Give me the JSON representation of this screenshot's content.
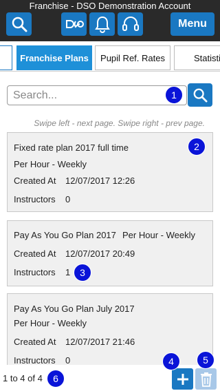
{
  "header": {
    "title": "Franchise - DSO Demonstration Account",
    "menu_label": "Menu"
  },
  "tabs": [
    {
      "label": "Franchise Plans",
      "active": true
    },
    {
      "label": "Pupil Ref. Rates",
      "active": false
    },
    {
      "label": "Statisti",
      "active": false
    }
  ],
  "search": {
    "placeholder": "Search...",
    "value": ""
  },
  "hint": "Swipe left - next page. Swipe right - prev page.",
  "plans": [
    {
      "name": "Fixed rate plan 2017 full time",
      "rate_type": "Per Hour - Weekly",
      "created_label": "Created At",
      "created_at": "12/07/2017 12:26",
      "instructors_label": "Instructors",
      "instructors": "0"
    },
    {
      "name": "Pay As You Go Plan 2017",
      "rate_type": "Per Hour - Weekly",
      "created_label": "Created At",
      "created_at": "12/07/2017 20:49",
      "instructors_label": "Instructors",
      "instructors": "1"
    },
    {
      "name": "Pay As You Go Plan July 2017",
      "rate_type": "Per Hour - Weekly",
      "created_label": "Created At",
      "created_at": "12/07/2017 21:46",
      "instructors_label": "Instructors",
      "instructors": "0"
    }
  ],
  "paging": "1 to 4 of 4",
  "markers": [
    "1",
    "2",
    "3",
    "4",
    "5",
    "6"
  ],
  "colors": {
    "header_bg": "#2a2a2a",
    "button_blue": "#1a78c2",
    "active_tab": "#1e90d8",
    "marker": "#0a14d8",
    "card_bg": "#f0f0f0",
    "delete_disabled": "#a8c8e8"
  },
  "icons": [
    "search-icon",
    "logo-icon",
    "bell-icon",
    "headset-icon",
    "plus-icon",
    "trash-icon"
  ]
}
